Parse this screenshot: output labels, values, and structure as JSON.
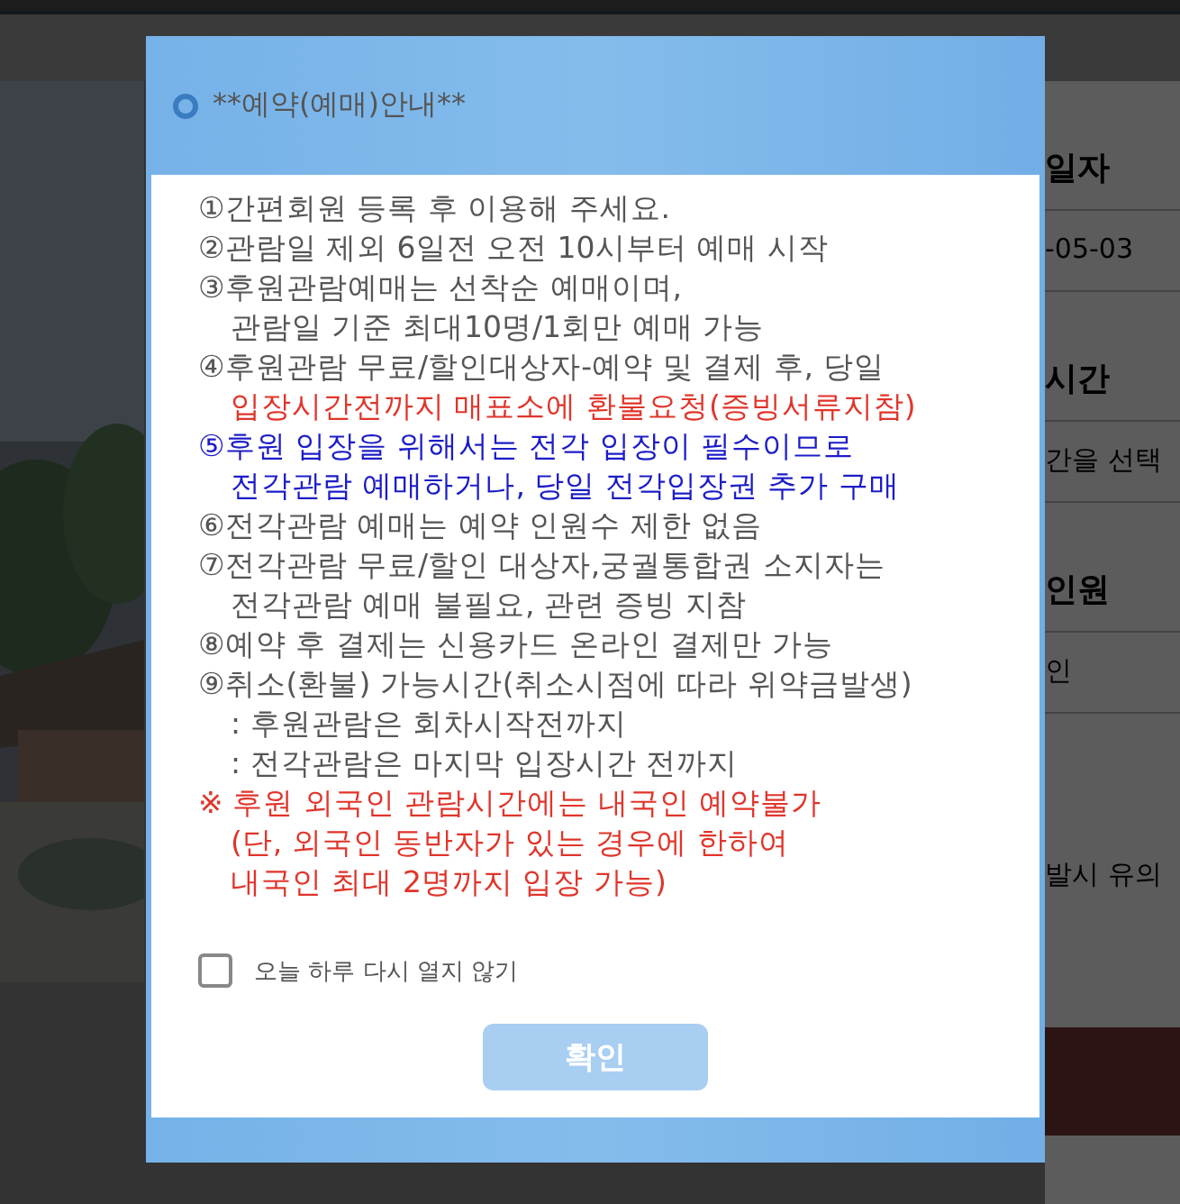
{
  "modal": {
    "title": "**예약(예매)안내**",
    "items": [
      {
        "lines": [
          {
            "text": "①간편회원 등록 후 이용해 주세요.",
            "kind": "normal"
          }
        ]
      },
      {
        "lines": [
          {
            "text": "②관람일 제외 6일전 오전 10시부터 예매 시작",
            "kind": "normal"
          }
        ]
      },
      {
        "lines": [
          {
            "text": "③후원관람예매는 선착순 예매이며,",
            "kind": "normal"
          },
          {
            "text": "관람일 기준 최대10명/1회만 예매 가능",
            "kind": "normal"
          }
        ]
      },
      {
        "lines": [
          {
            "text": "④후원관람 무료/할인대상자-예약 및 결제 후, 당일",
            "kind": "normal"
          },
          {
            "text": "입장시간전까지 매표소에 환불요청(증빙서류지참)",
            "kind": "warning"
          }
        ]
      },
      {
        "lines": [
          {
            "text": "⑤후원 입장을 위해서는 전각 입장이 필수이므로",
            "kind": "notice"
          },
          {
            "text": "전각관람 예매하거나, 당일 전각입장권 추가 구매",
            "kind": "notice"
          }
        ]
      },
      {
        "lines": [
          {
            "text": "⑥전각관람 예매는 예약 인원수 제한 없음",
            "kind": "normal"
          }
        ]
      },
      {
        "lines": [
          {
            "text": "⑦전각관람 무료/할인 대상자,궁궐통합권 소지자는",
            "kind": "normal"
          },
          {
            "text": "전각관람 예매 불필요, 관련 증빙 지참",
            "kind": "normal"
          }
        ]
      },
      {
        "lines": [
          {
            "text": "⑧예약 후 결제는 신용카드 온라인 결제만 가능",
            "kind": "normal"
          }
        ]
      },
      {
        "lines": [
          {
            "text": "⑨취소(환불) 가능시간(취소시점에 따라 위약금발생)",
            "kind": "normal"
          },
          {
            "text": ": 후원관람은 회차시작전까지",
            "kind": "normal"
          },
          {
            "text": ": 전각관람은 마지막 입장시간 전까지",
            "kind": "normal"
          }
        ]
      },
      {
        "lines": [
          {
            "text": "※ 후원 외국인 관람시간에는 내국인 예약불가",
            "kind": "warning"
          },
          {
            "text": "(단, 외국인 동반자가 있는 경우에 한하여",
            "kind": "warning"
          },
          {
            "text": "내국인 최대 2명까지 입장 가능)",
            "kind": "warning"
          }
        ]
      }
    ],
    "checkbox": {
      "label": "오늘 하루 다시 열지 않기",
      "checked": false
    },
    "button": {
      "label": "확인"
    }
  },
  "side_panel": [
    {
      "kind": "heading",
      "text": "일자"
    },
    {
      "kind": "value",
      "text": "-05-03"
    },
    {
      "kind": "heading",
      "text": "시간"
    },
    {
      "kind": "value",
      "text": "간을 선택"
    },
    {
      "kind": "heading",
      "text": "인원"
    },
    {
      "kind": "value",
      "text": "인"
    },
    {
      "kind": "note",
      "text": "발시 유의"
    }
  ]
}
